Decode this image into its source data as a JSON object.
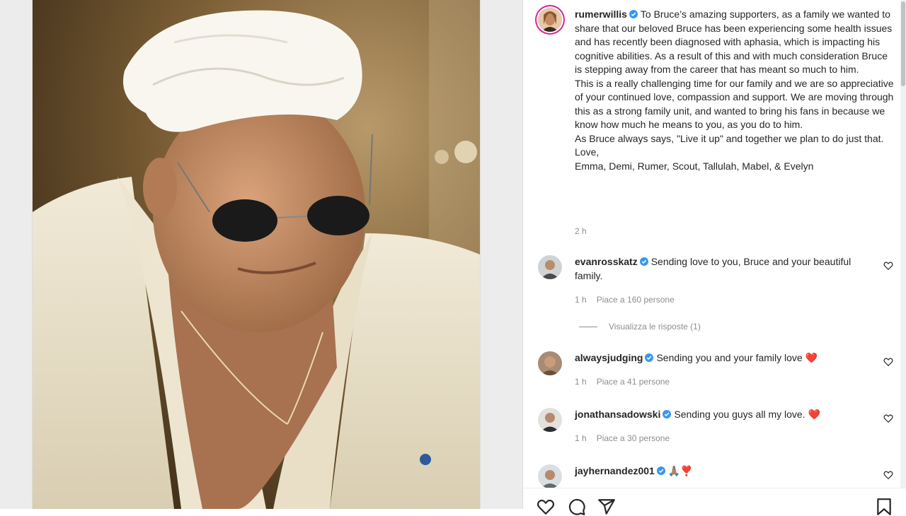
{
  "post": {
    "username": "rumerwillis",
    "caption_paragraphs": [
      "To Bruce’s amazing supporters, as a family we wanted to share that our beloved Bruce has been experiencing some health issues and has recently been diagnosed with aphasia, which is impacting his cognitive abilities. As a result of this and with much consideration Bruce is stepping away from the career that has meant so much to him.",
      "This is a really challenging time for our family and we are so appreciative of your continued love, compassion and support. We are moving through this as a strong family unit, and wanted to bring his fans in because we know how much he means to you, as you do to him.",
      "As Bruce always says, \"Live it up\" and together we plan to do just that.",
      "Love,",
      "Emma, Demi, Rumer, Scout, Tallulah, Mabel, & Evelyn"
    ],
    "time": "2 h"
  },
  "comments": [
    {
      "username": "evanrosskatz",
      "text": "Sending love to you, Bruce and your beautiful family.",
      "time": "1 h",
      "likes": "Piace a 160 persone"
    },
    {
      "username": "alwaysjudging",
      "text": "Sending you and your family love ❤️",
      "time": "1 h",
      "likes": "Piace a 41 persone"
    },
    {
      "username": "jonathansadowski",
      "text": "Sending you guys all my love. ❤️",
      "time": "1 h",
      "likes": "Piace a 30 persone"
    },
    {
      "username": "jayhernandez001",
      "text": "🙏🏽❣️"
    }
  ],
  "view_replies": "Visualizza le risposte (1)",
  "colors": {
    "verified": "#3897f0",
    "story_ring": "#d6249f",
    "secondary_text": "#8e8e8e"
  },
  "icons": [
    "verified-icon",
    "heart-icon",
    "comment-icon",
    "share-icon",
    "bookmark-icon"
  ]
}
